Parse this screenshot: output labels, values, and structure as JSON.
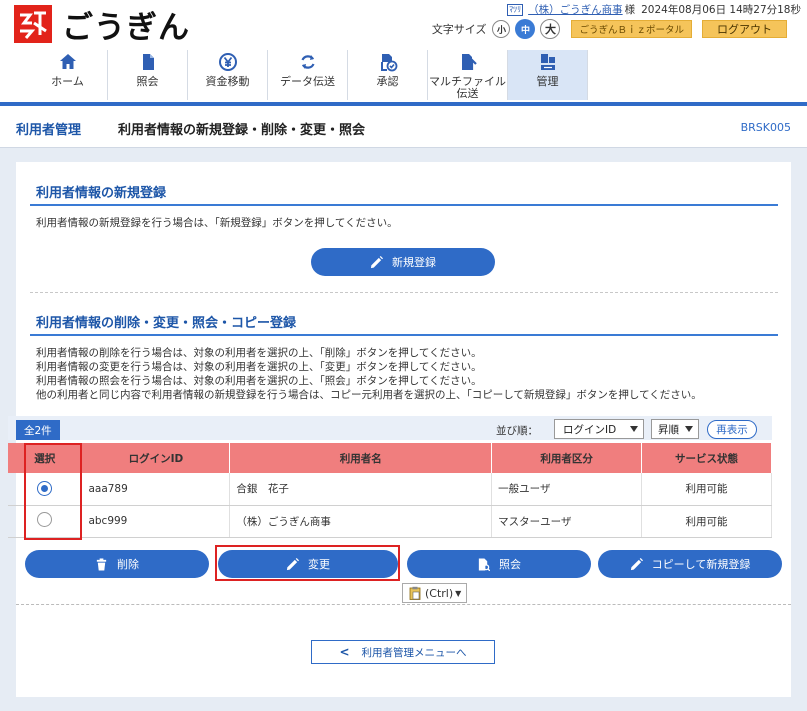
{
  "header": {
    "brand": "ごうぎん",
    "user_ruby": "ﾏﾂﾘ",
    "company": "（株）ごうぎん商事",
    "honorific": "様",
    "datetime": "2024年08月06日 14時27分18秒",
    "font_size_label": "文字サイズ",
    "font_sizes": [
      "小",
      "中",
      "大"
    ],
    "biz_portal": "ごうぎんＢｉｚポータル",
    "logout": "ログアウト"
  },
  "nav": [
    {
      "label": "ホーム",
      "icon": "home-icon"
    },
    {
      "label": "照会",
      "icon": "document-icon"
    },
    {
      "label": "資金移動",
      "icon": "yen-transfer-icon"
    },
    {
      "label": "データ伝送",
      "icon": "refresh-icon"
    },
    {
      "label": "承認",
      "icon": "approve-icon"
    },
    {
      "label": "マルチファイル\n伝送",
      "icon": "upload-file-icon"
    },
    {
      "label": "管理",
      "icon": "admin-icon"
    }
  ],
  "title": {
    "crumb": "利用者管理",
    "page_title": "利用者情報の新規登録・削除・変更・照会",
    "screen_id": "BRSK005"
  },
  "new_section": {
    "title": "利用者情報の新規登録",
    "desc": "利用者情報の新規登録を行う場合は、「新規登録」ボタンを押してください。",
    "button": "新規登録"
  },
  "edit_section": {
    "title": "利用者情報の削除・変更・照会・コピー登録",
    "desc": [
      "利用者情報の削除を行う場合は、対象の利用者を選択の上、「削除」ボタンを押してください。",
      "利用者情報の変更を行う場合は、対象の利用者を選択の上、「変更」ボタンを押してください。",
      "利用者情報の照会を行う場合は、対象の利用者を選択の上、「照会」ボタンを押してください。",
      "他の利用者と同じ内容で利用者情報の新規登録を行う場合は、コピー元利用者を選択の上、「コピーして新規登録」ボタンを押してください。"
    ]
  },
  "list": {
    "total": "全2件",
    "sort_label": "並び順：",
    "sort_key": "ログインID",
    "sort_order": "昇順",
    "redisplay": "再表示",
    "columns": [
      "選択",
      "ログインID",
      "利用者名",
      "利用者区分",
      "サービス状態"
    ],
    "rows": [
      {
        "selected": true,
        "login_id": "aaa789",
        "name": "合銀　花子",
        "category": "一般ユーザ",
        "status": "利用可能"
      },
      {
        "selected": false,
        "login_id": "abc999",
        "name": "（株）ごうぎん商事",
        "category": "マスターユーザ",
        "status": "利用可能"
      }
    ]
  },
  "actions": {
    "delete": "削除",
    "change": "変更",
    "inquiry": "照会",
    "copy_new": "コピーして新規登録"
  },
  "paste_chip": "(Ctrl)",
  "back": "利用者管理メニューへ",
  "colors": {
    "accent": "#2f6bc7",
    "header_row": "#f07e7e",
    "highlight": "#dd2222"
  }
}
